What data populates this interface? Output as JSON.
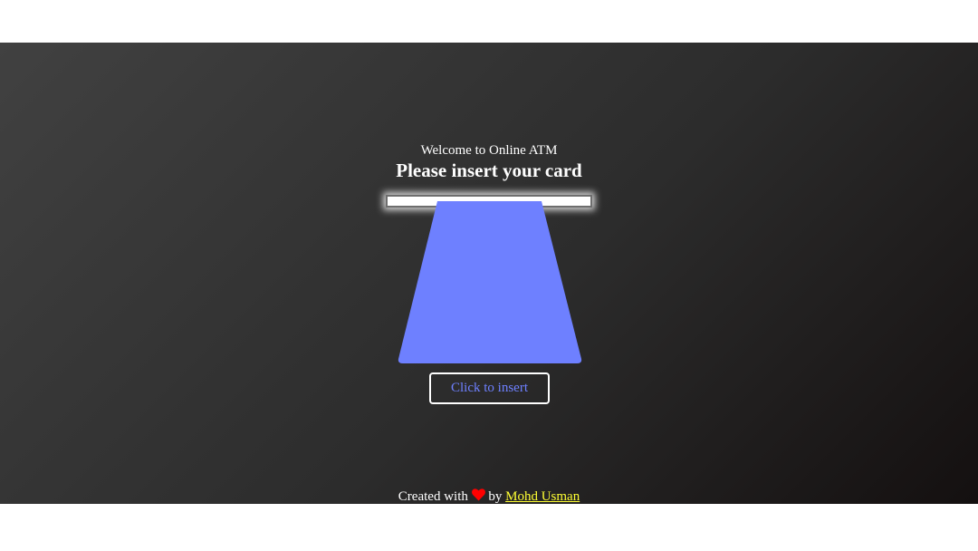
{
  "header": {
    "welcome": "Welcome to Online ATM",
    "title": "Please insert your card"
  },
  "card": {
    "color": "#6e80ff",
    "slot_color": "#ffffff"
  },
  "actions": {
    "insert_label": "Click to insert"
  },
  "footer": {
    "prefix": "Created with",
    "icon": "heart-icon",
    "heart_color": "#ff0000",
    "by": "by",
    "author": "Mohd Usman",
    "author_color": "#ffff33"
  },
  "theme": {
    "background_start": "#414141",
    "background_end": "#141010",
    "text": "#ffffff"
  }
}
